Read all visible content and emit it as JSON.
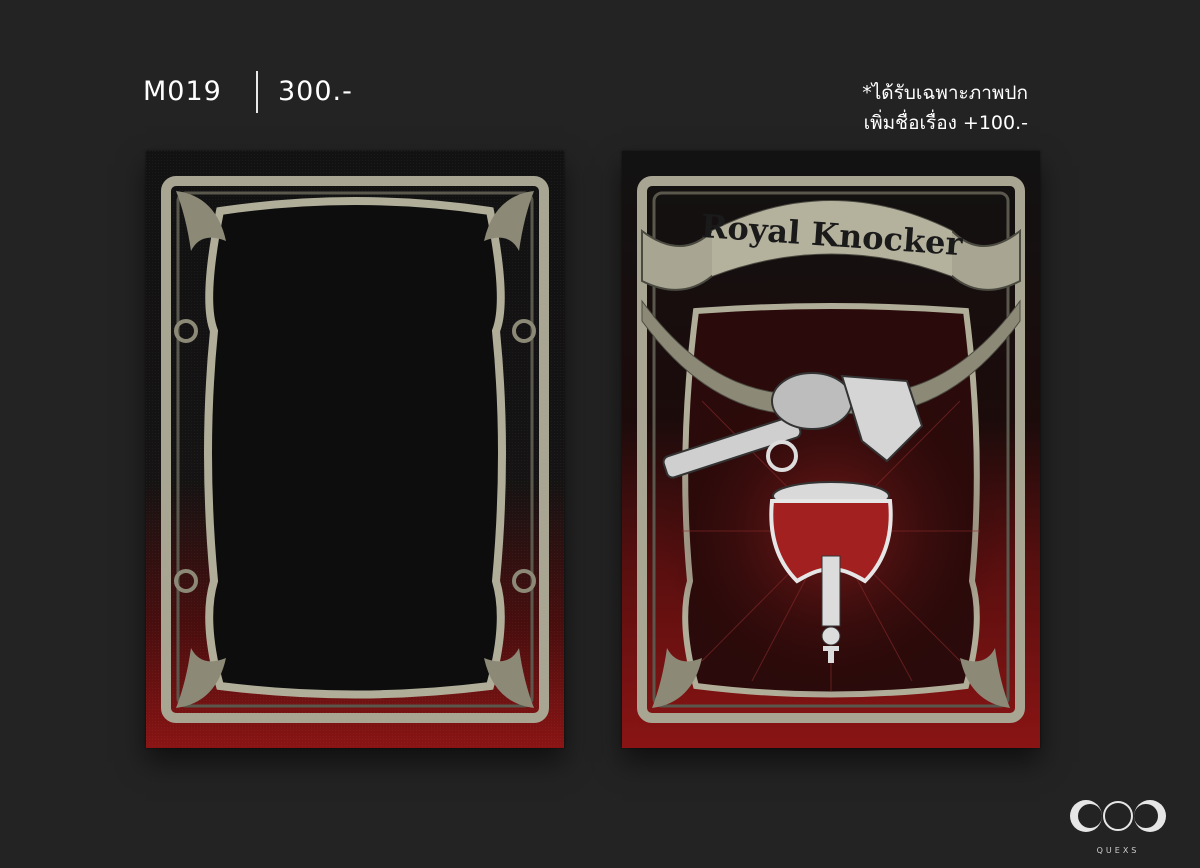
{
  "product": {
    "code": "M019",
    "price": "300.-"
  },
  "note": {
    "line1": "*ได้รับเฉพาะภาพปก",
    "line2": "เพิ่มชื่อเรื่อง +100.-"
  },
  "cover": {
    "title": "Royal Knocker"
  },
  "brand": {
    "logo_text": "QUEXS"
  },
  "colors": {
    "background": "#232323",
    "book_top": "#121212",
    "book_bottom": "#8a1414",
    "ornament": "#a8a592",
    "ornament_dark": "#4a4a40"
  }
}
